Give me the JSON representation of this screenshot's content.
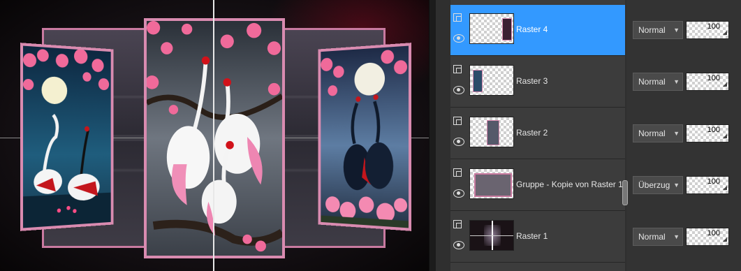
{
  "canvas": {
    "description_icon": "image-canvas",
    "frame_color": "#d98bb0"
  },
  "layers": [
    {
      "name": "Raster 4",
      "blend": "Normal",
      "opacity": "100",
      "selected": true
    },
    {
      "name": "Raster 3",
      "blend": "Normal",
      "opacity": "100",
      "selected": false
    },
    {
      "name": "Raster 2",
      "blend": "Normal",
      "opacity": "100",
      "selected": false
    },
    {
      "name": "Gruppe - Kopie von Raster 1",
      "blend": "Überzug",
      "opacity": "100",
      "selected": false
    },
    {
      "name": "Raster 1",
      "blend": "Normal",
      "opacity": "100",
      "selected": false
    }
  ],
  "colors": {
    "selection": "#3399ff",
    "panel": "#3c3c3c"
  }
}
